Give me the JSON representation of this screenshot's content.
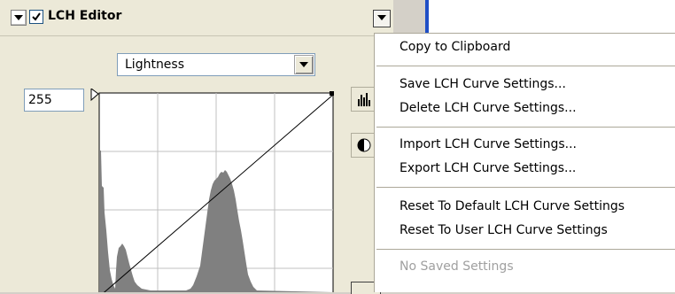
{
  "panel": {
    "title": "LCH Editor",
    "enabled_checked": true,
    "channel_selected": "Lightness",
    "max_value": "255"
  },
  "icons": {
    "collapse": "triangle-down-icon",
    "enable": "checkbox-icon",
    "panel_menu": "triangle-down-icon",
    "histogram": "histogram-icon",
    "invert": "half-circle-icon"
  },
  "context_menu": {
    "copy": "Copy to Clipboard",
    "save": "Save LCH Curve Settings...",
    "delete": "Delete LCH Curve Settings...",
    "import": "Import LCH Curve Settings...",
    "export": "Export LCH Curve Settings...",
    "reset_default": "Reset To Default LCH Curve Settings",
    "reset_user": "Reset To User LCH Curve Settings",
    "no_saved": "No Saved Settings"
  },
  "colors": {
    "accent_blue": "#1f4ec6",
    "histogram": "#808080",
    "disabled_text": "#a0a0a0"
  }
}
